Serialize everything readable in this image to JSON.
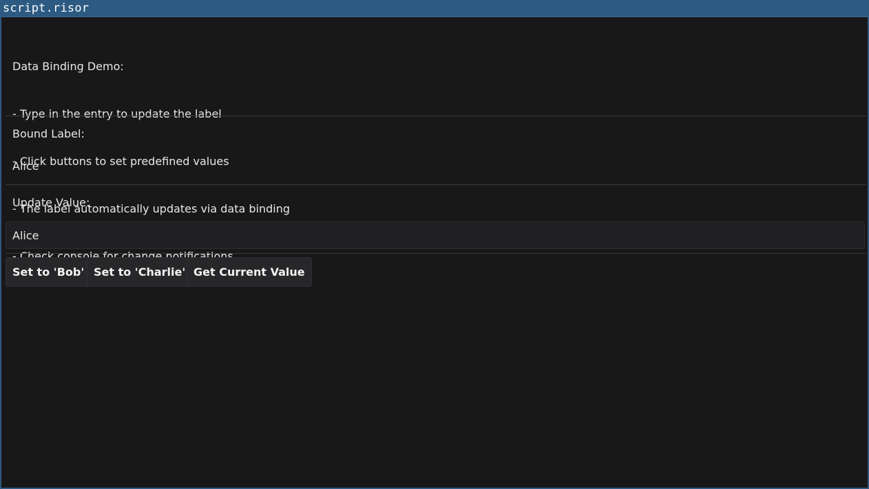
{
  "window": {
    "title": "script.risor"
  },
  "instructions": {
    "lines": [
      "Data Binding Demo:",
      "- Type in the entry to update the label",
      "- Click buttons to set predefined values",
      "- The label automatically updates via data binding",
      "- Check console for change notifications"
    ]
  },
  "bound": {
    "heading": "Bound Label:",
    "value": "Alice"
  },
  "update": {
    "heading": "Update Value:",
    "entry_value": "Alice"
  },
  "buttons": {
    "set_bob": "Set to 'Bob'",
    "set_charlie": "Set to 'Charlie'",
    "get_current": "Get Current Value"
  },
  "colors": {
    "titlebar": "#2c5a82",
    "background": "#181818",
    "button": "#27272a",
    "entry": "#202022"
  }
}
